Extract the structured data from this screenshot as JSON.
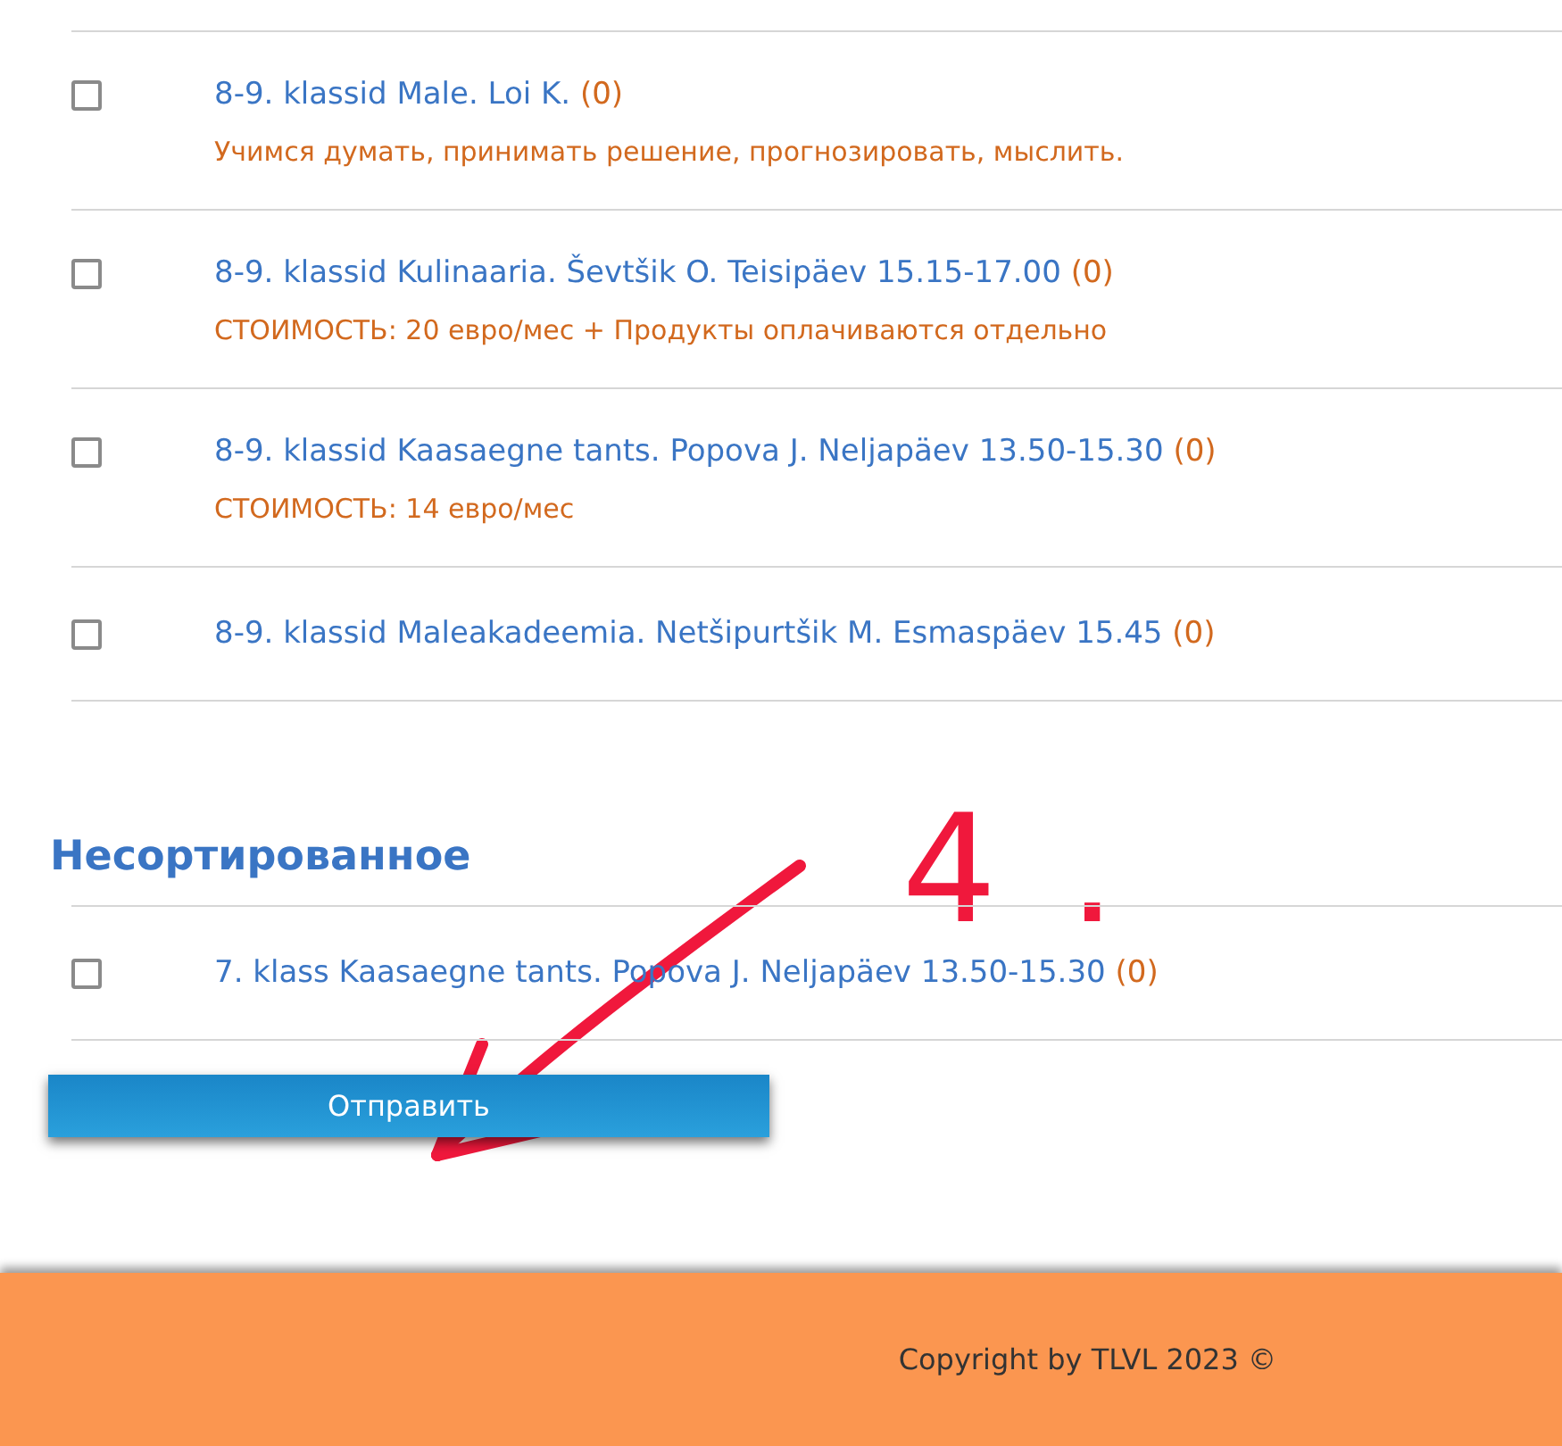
{
  "courses": [
    {
      "title": "8-9. klassid Male. Loi K.",
      "count": "(0)",
      "note": "Учимся думать, принимать решение, прогнозировать, мыслить.",
      "checked": false
    },
    {
      "title": "8-9. klassid Kulinaaria. Ševtšik O. Teisipäev 15.15-17.00",
      "count": "(0)",
      "note": "СТОИМОСТЬ: 20 евро/мес + Продукты оплачиваются отдельно",
      "checked": false
    },
    {
      "title": "8-9. klassid Kaasaegne tants. Popova J. Neljapäev 13.50-15.30",
      "count": "(0)",
      "note": "СТОИМОСТЬ: 14 евро/мес",
      "checked": false
    },
    {
      "title": "8-9. klassid Maleakadeemia. Netšipurtšik M. Esmaspäev 15.45",
      "count": "(0)",
      "checked": false
    }
  ],
  "unsorted": {
    "heading": "Несортированное",
    "courses": [
      {
        "title": "7. klass Kaasaegne tants. Popova J. Neljapäev 13.50-15.30",
        "count": "(0)",
        "checked": false
      }
    ]
  },
  "submit_button": "Отправить",
  "annotation": {
    "label": "4."
  },
  "footer": "Copyright by TLVL 2023 ©"
}
